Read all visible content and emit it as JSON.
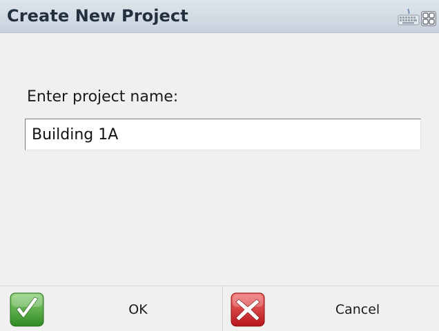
{
  "window": {
    "title": "Create New Project",
    "title_icons": [
      "keyboard-icon",
      "grid-view-icon"
    ]
  },
  "form": {
    "prompt_label": "Enter project name:",
    "project_name_value": "Building 1A",
    "text_cursor_visible": true
  },
  "buttons": {
    "ok": {
      "label": "OK",
      "icon": "checkmark-icon",
      "color": "#3f9a2f"
    },
    "cancel": {
      "label": "Cancel",
      "icon": "red-x-icon",
      "color": "#d5262b"
    }
  },
  "colors": {
    "titlebar": "#c8d1dc",
    "title_text": "#22303f",
    "background": "#f0f0f0",
    "input_background": "#ffffff"
  }
}
